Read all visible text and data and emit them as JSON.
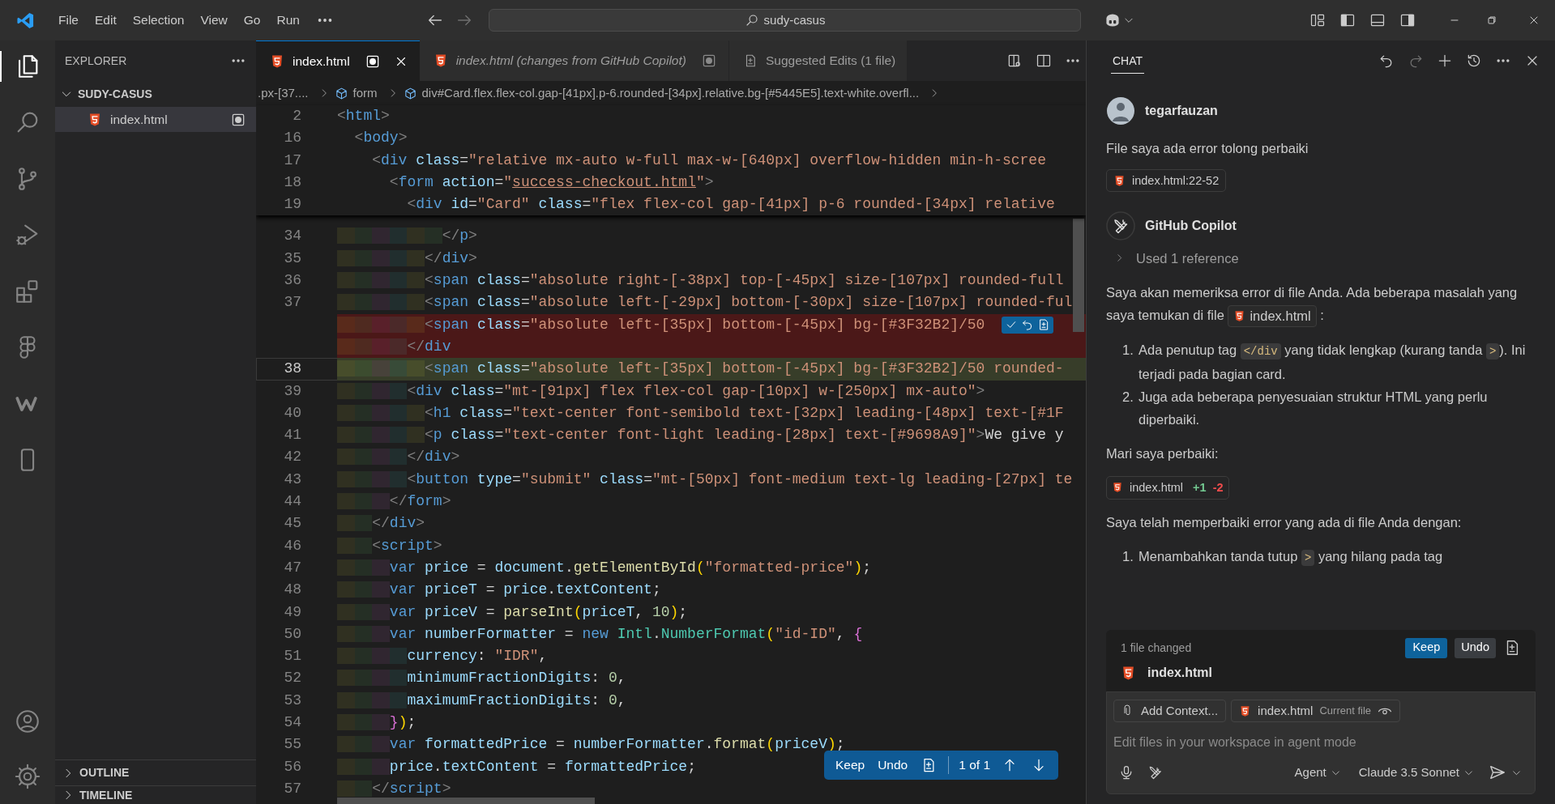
{
  "title_bar": {
    "menus": [
      "File",
      "Edit",
      "Selection",
      "View",
      "Go",
      "Run"
    ],
    "search": "sudy-casus"
  },
  "activity_bar": {
    "items": [
      {
        "selected": true
      },
      {
        "selected": false
      },
      {
        "selected": false
      },
      {
        "selected": false
      },
      {
        "selected": false
      },
      {
        "selected": false
      },
      {
        "selected": false
      },
      {
        "selected": false
      }
    ]
  },
  "sidebar": {
    "title": "EXPLORER",
    "folder": {
      "name": "SUDY-CASUS",
      "expanded": true,
      "children": [
        {
          "name": "index.html",
          "selected": true,
          "modified": true
        }
      ]
    },
    "sections": [
      {
        "name": "OUTLINE",
        "expanded": false
      },
      {
        "name": "TIMELINE",
        "expanded": false
      }
    ]
  },
  "editor": {
    "tabs": [
      {
        "label": "index.html",
        "kind": "file",
        "selected": true,
        "preview": false,
        "dirty": true
      },
      {
        "label": "index.html (changes from GitHub Copilot)",
        "kind": "file",
        "selected": false,
        "preview": true,
        "dirty": true
      },
      {
        "label": "Suggested Edits (1 file)",
        "kind": "diff",
        "selected": false,
        "preview": false,
        "dirty": false
      }
    ],
    "breadcrumbs": [
      {
        "text": ".px-[37....",
        "symbol": false
      },
      {
        "text": "form",
        "symbol": true
      },
      {
        "text": "div#Card.flex.flex-col.gap-[41px].p-6.rounded-[34px].relative.bg-[#5445E5].text-white.overfl...",
        "symbol": true
      }
    ],
    "sticky_lines": [
      {
        "number": "2",
        "tokens": [
          {
            "kind": "punct",
            "text": "<"
          },
          {
            "kind": "tag",
            "text": "html"
          },
          {
            "kind": "punct",
            "text": ">"
          }
        ]
      },
      {
        "number": "16",
        "tokens": [
          {
            "kind": "punct",
            "text": "  <"
          },
          {
            "kind": "tag",
            "text": "body"
          },
          {
            "kind": "punct",
            "text": ">"
          }
        ]
      },
      {
        "number": "17",
        "tokens": [
          {
            "kind": "punct",
            "text": "    <"
          },
          {
            "kind": "tag",
            "text": "div"
          },
          {
            "kind": "attr",
            "text": " class"
          },
          {
            "kind": "op",
            "text": "="
          },
          {
            "kind": "str",
            "text": "\"relative mx-auto w-full max-w-[640px] overflow-hidden min-h-scree"
          }
        ]
      },
      {
        "number": "18",
        "tokens": [
          {
            "kind": "punct",
            "text": "      <"
          },
          {
            "kind": "tag",
            "text": "form"
          },
          {
            "kind": "attr",
            "text": " action"
          },
          {
            "kind": "op",
            "text": "="
          },
          {
            "kind": "str",
            "text": "\""
          },
          {
            "kind": "link",
            "text": "success-checkout.html"
          },
          {
            "kind": "str",
            "text": "\""
          },
          {
            "kind": "punct",
            "text": ">"
          }
        ]
      },
      {
        "number": "19",
        "tokens": [
          {
            "kind": "punct",
            "text": "        <"
          },
          {
            "kind": "tag",
            "text": "div"
          },
          {
            "kind": "attr",
            "text": " id"
          },
          {
            "kind": "op",
            "text": "="
          },
          {
            "kind": "str",
            "text": "\"Card\""
          },
          {
            "kind": "attr",
            "text": " class"
          },
          {
            "kind": "op",
            "text": "="
          },
          {
            "kind": "str",
            "text": "\"flex flex-col gap-[41px] p-6 rounded-[34px] relative"
          }
        ]
      }
    ],
    "lines": [
      {
        "number": "34",
        "deleted": false,
        "added": false,
        "current": false,
        "hunk_actions": false,
        "tokens": [
          {
            "kind": "punct",
            "text": "            </"
          },
          {
            "kind": "tag",
            "text": "p"
          },
          {
            "kind": "punct",
            "text": ">"
          }
        ]
      },
      {
        "number": "35",
        "deleted": false,
        "added": false,
        "current": false,
        "hunk_actions": false,
        "tokens": [
          {
            "kind": "punct",
            "text": "          </"
          },
          {
            "kind": "tag",
            "text": "div"
          },
          {
            "kind": "punct",
            "text": ">"
          }
        ]
      },
      {
        "number": "36",
        "deleted": false,
        "added": false,
        "current": false,
        "hunk_actions": false,
        "tokens": [
          {
            "kind": "punct",
            "text": "          <"
          },
          {
            "kind": "tag",
            "text": "span"
          },
          {
            "kind": "attr",
            "text": " class"
          },
          {
            "kind": "op",
            "text": "="
          },
          {
            "kind": "str",
            "text": "\"absolute right-[-38px] top-[-45px] size-[107px] rounded-full"
          }
        ]
      },
      {
        "number": "37",
        "deleted": false,
        "added": false,
        "current": false,
        "hunk_actions": false,
        "tokens": [
          {
            "kind": "punct",
            "text": "          <"
          },
          {
            "kind": "tag",
            "text": "span"
          },
          {
            "kind": "attr",
            "text": " class"
          },
          {
            "kind": "op",
            "text": "="
          },
          {
            "kind": "str",
            "text": "\"absolute left-[-29px] bottom-[-30px] size-[107px] rounded-ful"
          }
        ]
      },
      {
        "deleted": true,
        "added": false,
        "current": false,
        "hunk_actions": true,
        "tokens": [
          {
            "kind": "punct",
            "text": "          <"
          },
          {
            "kind": "tag",
            "text": "span"
          },
          {
            "kind": "attr",
            "text": " class"
          },
          {
            "kind": "op",
            "text": "="
          },
          {
            "kind": "str",
            "text": "\"absolute left-[35px] bottom-[-45px] bg-[#3F32B2]/50"
          }
        ]
      },
      {
        "deleted": true,
        "added": false,
        "current": false,
        "hunk_actions": false,
        "tokens": [
          {
            "kind": "punct",
            "text": "        </"
          },
          {
            "kind": "tag",
            "text": "div"
          }
        ]
      },
      {
        "number": "38",
        "deleted": false,
        "added": true,
        "current": true,
        "hunk_actions": false,
        "tokens": [
          {
            "kind": "punct",
            "text": "          <"
          },
          {
            "kind": "tag",
            "text": "span"
          },
          {
            "kind": "attr",
            "text": " class"
          },
          {
            "kind": "op",
            "text": "="
          },
          {
            "kind": "str",
            "text": "\"absolute left-[35px] bottom-[-45px] bg-[#3F32B2]/50 rounded-"
          }
        ]
      },
      {
        "number": "39",
        "deleted": false,
        "added": false,
        "current": false,
        "hunk_actions": false,
        "tokens": [
          {
            "kind": "punct",
            "text": "        <"
          },
          {
            "kind": "tag",
            "text": "div"
          },
          {
            "kind": "attr",
            "text": " class"
          },
          {
            "kind": "op",
            "text": "="
          },
          {
            "kind": "str",
            "text": "\"mt-[91px] flex flex-col gap-[10px] w-[250px] mx-auto\""
          },
          {
            "kind": "punct",
            "text": ">"
          }
        ]
      },
      {
        "number": "40",
        "deleted": false,
        "added": false,
        "current": false,
        "hunk_actions": false,
        "tokens": [
          {
            "kind": "punct",
            "text": "          <"
          },
          {
            "kind": "tag",
            "text": "h1"
          },
          {
            "kind": "attr",
            "text": " class"
          },
          {
            "kind": "op",
            "text": "="
          },
          {
            "kind": "str",
            "text": "\"text-center font-semibold text-[32px] leading-[48px] text-[#1F"
          }
        ]
      },
      {
        "number": "41",
        "deleted": false,
        "added": false,
        "current": false,
        "hunk_actions": false,
        "tokens": [
          {
            "kind": "punct",
            "text": "          <"
          },
          {
            "kind": "tag",
            "text": "p"
          },
          {
            "kind": "attr",
            "text": " class"
          },
          {
            "kind": "op",
            "text": "="
          },
          {
            "kind": "str",
            "text": "\"text-center font-light leading-[28px] text-[#9698A9]\""
          },
          {
            "kind": "punct",
            "text": ">"
          },
          {
            "kind": "text",
            "text": "We give y"
          }
        ]
      },
      {
        "number": "42",
        "deleted": false,
        "added": false,
        "current": false,
        "hunk_actions": false,
        "tokens": [
          {
            "kind": "punct",
            "text": "        </"
          },
          {
            "kind": "tag",
            "text": "div"
          },
          {
            "kind": "punct",
            "text": ">"
          }
        ]
      },
      {
        "number": "43",
        "deleted": false,
        "added": false,
        "current": false,
        "hunk_actions": false,
        "tokens": [
          {
            "kind": "punct",
            "text": "        <"
          },
          {
            "kind": "tag",
            "text": "button"
          },
          {
            "kind": "attr",
            "text": " type"
          },
          {
            "kind": "op",
            "text": "="
          },
          {
            "kind": "str",
            "text": "\"submit\""
          },
          {
            "kind": "attr",
            "text": " class"
          },
          {
            "kind": "op",
            "text": "="
          },
          {
            "kind": "str",
            "text": "\"mt-[50px] font-medium text-lg leading-[27px] te"
          }
        ]
      },
      {
        "number": "44",
        "deleted": false,
        "added": false,
        "current": false,
        "hunk_actions": false,
        "tokens": [
          {
            "kind": "punct",
            "text": "      </"
          },
          {
            "kind": "tag",
            "text": "form"
          },
          {
            "kind": "punct",
            "text": ">"
          }
        ]
      },
      {
        "number": "45",
        "deleted": false,
        "added": false,
        "current": false,
        "hunk_actions": false,
        "tokens": [
          {
            "kind": "punct",
            "text": "    </"
          },
          {
            "kind": "tag",
            "text": "div"
          },
          {
            "kind": "punct",
            "text": ">"
          }
        ]
      },
      {
        "number": "46",
        "deleted": false,
        "added": false,
        "current": false,
        "hunk_actions": false,
        "tokens": [
          {
            "kind": "punct",
            "text": "    <"
          },
          {
            "kind": "tag",
            "text": "script"
          },
          {
            "kind": "punct",
            "text": ">"
          }
        ]
      },
      {
        "number": "47",
        "deleted": false,
        "added": false,
        "current": false,
        "hunk_actions": false,
        "tokens": [
          {
            "kind": "kw",
            "text": "      var"
          },
          {
            "kind": "var",
            "text": " price"
          },
          {
            "kind": "op",
            "text": " = "
          },
          {
            "kind": "var",
            "text": "document"
          },
          {
            "kind": "op",
            "text": "."
          },
          {
            "kind": "fn",
            "text": "getElementById"
          },
          {
            "kind": "br1",
            "text": "("
          },
          {
            "kind": "str",
            "text": "\"formatted-price\""
          },
          {
            "kind": "br1",
            "text": ")"
          },
          {
            "kind": "op",
            "text": ";"
          }
        ]
      },
      {
        "number": "48",
        "deleted": false,
        "added": false,
        "current": false,
        "hunk_actions": false,
        "tokens": [
          {
            "kind": "kw",
            "text": "      var"
          },
          {
            "kind": "var",
            "text": " priceT"
          },
          {
            "kind": "op",
            "text": " = "
          },
          {
            "kind": "var",
            "text": "price"
          },
          {
            "kind": "op",
            "text": "."
          },
          {
            "kind": "var",
            "text": "textContent"
          },
          {
            "kind": "op",
            "text": ";"
          }
        ]
      },
      {
        "number": "49",
        "deleted": false,
        "added": false,
        "current": false,
        "hunk_actions": false,
        "tokens": [
          {
            "kind": "kw",
            "text": "      var"
          },
          {
            "kind": "var",
            "text": " priceV"
          },
          {
            "kind": "op",
            "text": " = "
          },
          {
            "kind": "fn",
            "text": "parseInt"
          },
          {
            "kind": "br1",
            "text": "("
          },
          {
            "kind": "var",
            "text": "priceT"
          },
          {
            "kind": "op",
            "text": ", "
          },
          {
            "kind": "num",
            "text": "10"
          },
          {
            "kind": "br1",
            "text": ")"
          },
          {
            "kind": "op",
            "text": ";"
          }
        ]
      },
      {
        "number": "50",
        "deleted": false,
        "added": false,
        "current": false,
        "hunk_actions": false,
        "tokens": [
          {
            "kind": "kw",
            "text": "      var"
          },
          {
            "kind": "var",
            "text": " numberFormatter"
          },
          {
            "kind": "op",
            "text": " = "
          },
          {
            "kind": "kw",
            "text": "new"
          },
          {
            "kind": "cls",
            "text": " Intl"
          },
          {
            "kind": "op",
            "text": "."
          },
          {
            "kind": "cls",
            "text": "NumberFormat"
          },
          {
            "kind": "br1",
            "text": "("
          },
          {
            "kind": "str",
            "text": "\"id-ID\""
          },
          {
            "kind": "op",
            "text": ", "
          },
          {
            "kind": "br2",
            "text": "{"
          }
        ]
      },
      {
        "number": "51",
        "deleted": false,
        "added": false,
        "current": false,
        "hunk_actions": false,
        "tokens": [
          {
            "kind": "var",
            "text": "        currency"
          },
          {
            "kind": "op",
            "text": ": "
          },
          {
            "kind": "str",
            "text": "\"IDR\""
          },
          {
            "kind": "op",
            "text": ","
          }
        ]
      },
      {
        "number": "52",
        "deleted": false,
        "added": false,
        "current": false,
        "hunk_actions": false,
        "tokens": [
          {
            "kind": "var",
            "text": "        minimumFractionDigits"
          },
          {
            "kind": "op",
            "text": ": "
          },
          {
            "kind": "num",
            "text": "0"
          },
          {
            "kind": "op",
            "text": ","
          }
        ]
      },
      {
        "number": "53",
        "deleted": false,
        "added": false,
        "current": false,
        "hunk_actions": false,
        "tokens": [
          {
            "kind": "var",
            "text": "        maximumFractionDigits"
          },
          {
            "kind": "op",
            "text": ": "
          },
          {
            "kind": "num",
            "text": "0"
          },
          {
            "kind": "op",
            "text": ","
          }
        ]
      },
      {
        "number": "54",
        "deleted": false,
        "added": false,
        "current": false,
        "hunk_actions": false,
        "tokens": [
          {
            "kind": "br2",
            "text": "      }"
          },
          {
            "kind": "br1",
            "text": ")"
          },
          {
            "kind": "op",
            "text": ";"
          }
        ]
      },
      {
        "number": "55",
        "deleted": false,
        "added": false,
        "current": false,
        "hunk_actions": false,
        "tokens": [
          {
            "kind": "kw",
            "text": "      var"
          },
          {
            "kind": "var",
            "text": " formattedPrice"
          },
          {
            "kind": "op",
            "text": " = "
          },
          {
            "kind": "var",
            "text": "numberFormatter"
          },
          {
            "kind": "op",
            "text": "."
          },
          {
            "kind": "fn",
            "text": "format"
          },
          {
            "kind": "br1",
            "text": "("
          },
          {
            "kind": "var",
            "text": "priceV"
          },
          {
            "kind": "br1",
            "text": ")"
          },
          {
            "kind": "op",
            "text": ";"
          }
        ]
      },
      {
        "number": "56",
        "deleted": false,
        "added": false,
        "current": false,
        "hunk_actions": false,
        "tokens": [
          {
            "kind": "var",
            "text": "      price"
          },
          {
            "kind": "op",
            "text": "."
          },
          {
            "kind": "var",
            "text": "textContent"
          },
          {
            "kind": "op",
            "text": " = "
          },
          {
            "kind": "var",
            "text": "formattedPrice"
          },
          {
            "kind": "op",
            "text": ";"
          }
        ]
      },
      {
        "number": "57",
        "deleted": false,
        "added": false,
        "current": false,
        "hunk_actions": false,
        "tokens": [
          {
            "kind": "punct",
            "text": "    </"
          },
          {
            "kind": "tag",
            "text": "script"
          },
          {
            "kind": "punct",
            "text": ">"
          }
        ]
      }
    ],
    "review_bar": {
      "keep": "Keep",
      "undo": "Undo",
      "position": "1 of 1"
    }
  },
  "chat": {
    "title": "CHAT",
    "messages": [
      {
        "kind": "user",
        "author": "tegarfauzan",
        "blocks": [
          {
            "kind": "paragraph",
            "parts": [
              {
                "kind": "text",
                "text": "File saya ada error tolong perbaiki"
              }
            ]
          },
          {
            "kind": "file_chip",
            "text": "index.html:22-52"
          }
        ]
      },
      {
        "kind": "assistant",
        "author": "GitHub Copilot",
        "blocks": [
          {
            "kind": "reference",
            "text": "Used 1 reference",
            "expanded": false
          },
          {
            "kind": "paragraph",
            "parts": [
              {
                "kind": "text",
                "text": "Saya akan memeriksa error di file Anda. Ada beberapa masalah yang saya temukan di file "
              },
              {
                "kind": "file",
                "text": "index.html"
              },
              {
                "kind": "text",
                "text": " :"
              }
            ]
          },
          {
            "kind": "list",
            "items": [
              {
                "number": "1.",
                "parts": [
                  {
                    "kind": "text",
                    "text": "Ada penutup tag "
                  },
                  {
                    "kind": "code",
                    "text": "</div"
                  },
                  {
                    "kind": "text",
                    "text": " yang tidak lengkap (kurang tanda "
                  },
                  {
                    "kind": "code",
                    "text": ">"
                  },
                  {
                    "kind": "text",
                    "text": "). Ini terjadi pada bagian card."
                  }
                ]
              },
              {
                "number": "2.",
                "parts": [
                  {
                    "kind": "text",
                    "text": "Juga ada beberapa penyesuaian struktur HTML yang perlu diperbaiki."
                  }
                ]
              }
            ]
          },
          {
            "kind": "paragraph",
            "parts": [
              {
                "kind": "text",
                "text": "Mari saya perbaiki:"
              }
            ]
          },
          {
            "kind": "edit_chip",
            "file": "index.html",
            "added": "+1",
            "removed": "-2"
          },
          {
            "kind": "paragraph",
            "parts": [
              {
                "kind": "text",
                "text": "Saya telah memperbaiki error yang ada di file Anda dengan:"
              }
            ]
          },
          {
            "kind": "list",
            "items": [
              {
                "number": "1.",
                "parts": [
                  {
                    "kind": "text",
                    "text": "Menambahkan tanda tutup "
                  },
                  {
                    "kind": "code",
                    "text": ">"
                  },
                  {
                    "kind": "text",
                    "text": " yang hilang pada tag"
                  }
                ]
              }
            ]
          }
        ]
      }
    ],
    "changes": {
      "summary": "1 file changed",
      "keep": "Keep",
      "undo": "Undo",
      "file": "index.html"
    },
    "input": {
      "chips": [
        {
          "kind": "add",
          "text": "Add Context..."
        },
        {
          "kind": "file",
          "text": "index.html",
          "note": "Current file"
        }
      ],
      "placeholder": "Edit files in your workspace in agent mode",
      "mode": "Agent",
      "model": "Claude 3.5 Sonnet"
    }
  }
}
